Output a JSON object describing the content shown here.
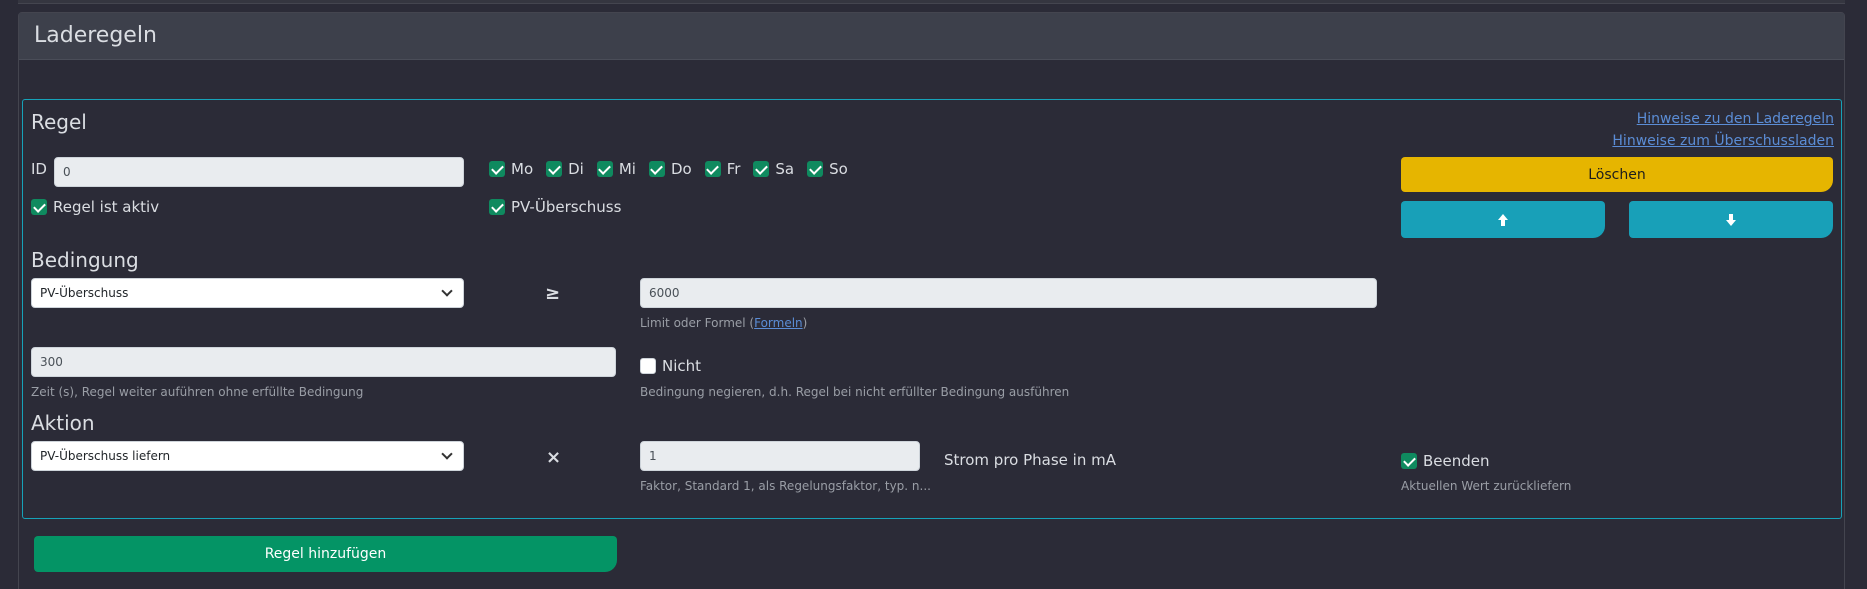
{
  "card": {
    "title": "Laderegeln"
  },
  "rule": {
    "title": "Regel",
    "links": {
      "hinweise_laderegeln": "Hinweise zu den Laderegeln",
      "hinweise_ueberschuss": "Hinweise zum Überschussladen"
    },
    "id_label": "ID",
    "id_value": "0",
    "days": [
      {
        "label": "Mo",
        "checked": true
      },
      {
        "label": "Di",
        "checked": true
      },
      {
        "label": "Mi",
        "checked": true
      },
      {
        "label": "Do",
        "checked": true
      },
      {
        "label": "Fr",
        "checked": true
      },
      {
        "label": "Sa",
        "checked": true
      },
      {
        "label": "So",
        "checked": true
      }
    ],
    "active_label": "Regel ist aktiv",
    "pv_label": "PV-Überschuss",
    "delete_label": "Löschen",
    "condition": {
      "title": "Bedingung",
      "selected": "PV-Überschuss",
      "operator": "≥",
      "limit_value": "6000",
      "limit_help_prefix": "Limit oder Formel (",
      "limit_help_link": "Formeln",
      "limit_help_suffix": ")",
      "time_value": "300",
      "time_help": "Zeit (s), Regel weiter auführen ohne erfüllte Bedingung",
      "not_label": "Nicht",
      "not_help": "Bedingung negieren, d.h. Regel bei nicht erfüllter Bedingung ausführen"
    },
    "action": {
      "title": "Aktion",
      "selected": "PV-Überschuss liefern",
      "operator": "×",
      "factor_value": "1",
      "unit_label": "Strom pro Phase in mA",
      "factor_help": "Faktor, Standard 1, als Regelungsfaktor, typ. n...",
      "end_label": "Beenden",
      "end_help": "Aktuellen Wert zurückliefern"
    }
  },
  "add_button": "Regel hinzufügen",
  "colors": {
    "accent": "#16a2b8",
    "warning": "#e6b500",
    "success": "#049465",
    "checkbox": "#0f8a5f"
  }
}
